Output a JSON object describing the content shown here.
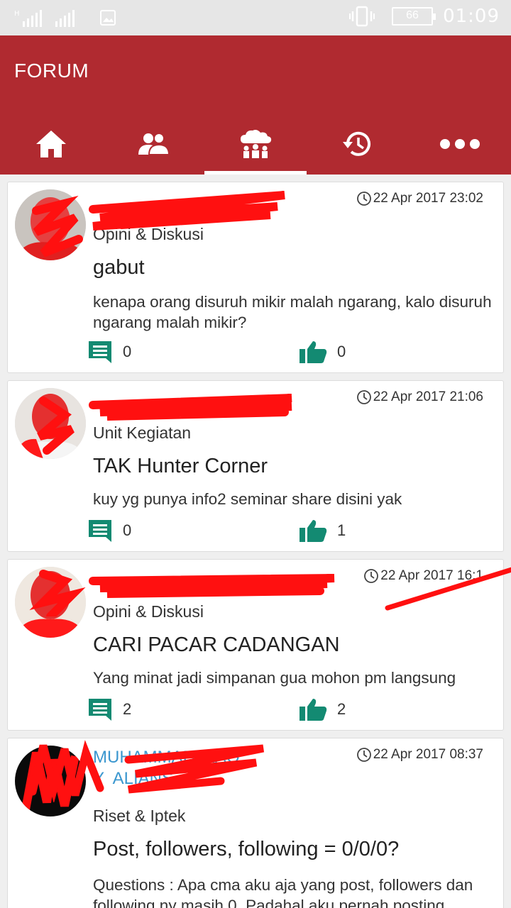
{
  "status_bar": {
    "time": "01:09",
    "battery": "66"
  },
  "app": {
    "title": "FORUM"
  },
  "tabs": [
    {
      "icon": "home-icon"
    },
    {
      "icon": "people-icon"
    },
    {
      "icon": "group-cloud-icon"
    },
    {
      "icon": "history-icon"
    },
    {
      "icon": "more-icon"
    }
  ],
  "posts": [
    {
      "timestamp": "22 Apr 2017 23:02",
      "category": "Opini & Diskusi",
      "title": "gabut",
      "body": "kenapa orang disuruh mikir malah ngarang, kalo disuruh ngarang malah mikir?",
      "comments": "0",
      "likes": "0"
    },
    {
      "timestamp": "22 Apr 2017 21:06",
      "category": "Unit Kegiatan",
      "title": "TAK Hunter Corner",
      "body": "kuy yg punya info2 seminar share disini yak",
      "comments": "0",
      "likes": "1"
    },
    {
      "timestamp": "22 Apr 2017 16:1",
      "category": "Opini & Diskusi",
      "title": "CARI PACAR CADANGAN",
      "body": "Yang minat jadi simpanan gua mohon pm langsung",
      "comments": "2",
      "likes": "2"
    },
    {
      "author": "MUHAMMAD  ZAQ\nY  ALIANS",
      "timestamp": "22 Apr 2017 08:37",
      "category": "Riset & Iptek",
      "title": "Post, followers, following = 0/0/0?",
      "body": "Questions : Apa cma aku aja yang post, followers dan following ny masih 0. Padahal aku pernah posting",
      "comments": "",
      "likes": ""
    }
  ],
  "colors": {
    "primary": "#b02a30",
    "teal": "#138a72",
    "author_link": "#3b97cf"
  }
}
